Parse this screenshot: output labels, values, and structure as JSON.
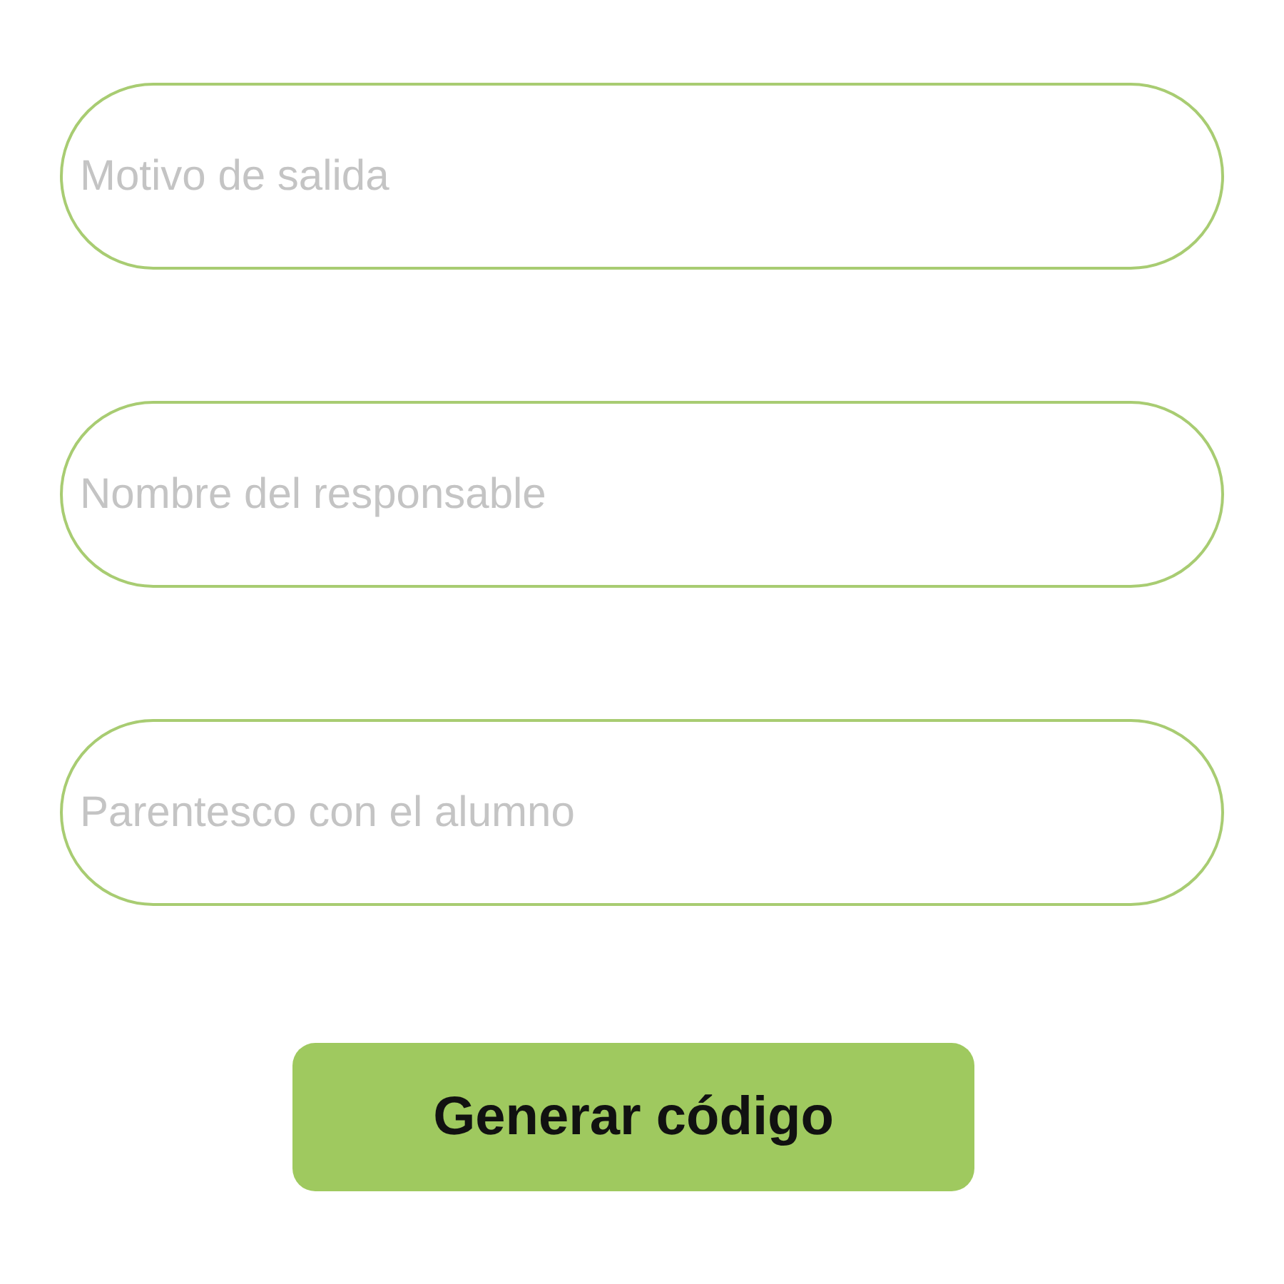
{
  "fields": [
    {
      "placeholder": "Motivo de salida"
    },
    {
      "placeholder": "Nombre del responsable"
    },
    {
      "placeholder": "Parentesco con el alumno"
    }
  ],
  "button": {
    "label": "Generar código"
  }
}
